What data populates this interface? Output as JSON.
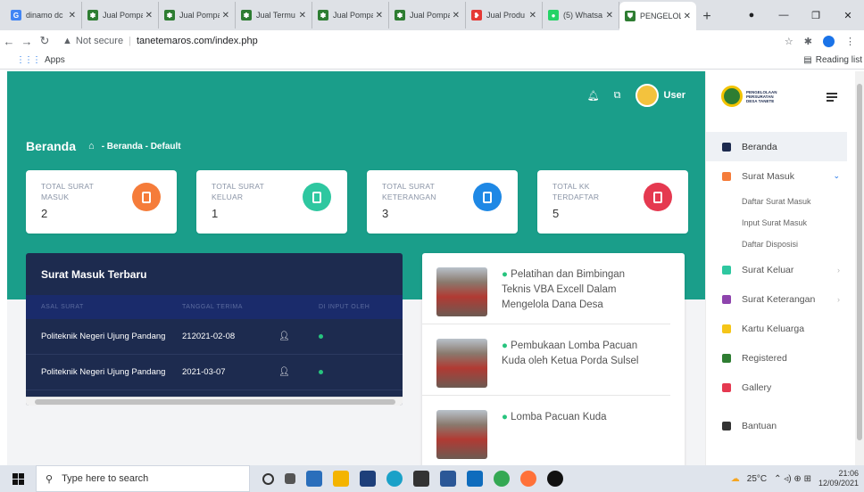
{
  "browser": {
    "tabs": [
      {
        "label": "dinamo dc",
        "color": "#4285f4",
        "glyph": "G"
      },
      {
        "label": "Jual Pompa",
        "color": "#2e7d32",
        "glyph": "✽"
      },
      {
        "label": "Jual Pompa",
        "color": "#2e7d32",
        "glyph": "✽"
      },
      {
        "label": "Jual Termu",
        "color": "#2e7d32",
        "glyph": "✽"
      },
      {
        "label": "Jual Pompa",
        "color": "#2e7d32",
        "glyph": "✽"
      },
      {
        "label": "Jual Pompa",
        "color": "#2e7d32",
        "glyph": "✽"
      },
      {
        "label": "Jual Produ",
        "color": "#e53935",
        "glyph": "❥"
      },
      {
        "label": "(5) Whatsa",
        "color": "#25d366",
        "glyph": "●"
      },
      {
        "label": "PENGELOL",
        "color": "#2e7d32",
        "glyph": "⛊"
      }
    ],
    "new_tab": "+",
    "window_controls": [
      "●",
      "—",
      "❐",
      "✕"
    ],
    "security": "Not secure",
    "url": "tanetemaros.com/index.php",
    "bookmarks_apps": "Apps",
    "reading_list": "Reading list"
  },
  "header": {
    "user": "User",
    "page_title": "Beranda",
    "breadcrumb": "Beranda",
    "breadcrumb_current": "Default"
  },
  "stats": [
    {
      "label": "TOTAL SURAT MASUK",
      "value": "2",
      "color": "#f57c3a"
    },
    {
      "label": "TOTAL SURAT KELUAR",
      "value": "1",
      "color": "#2ec7a0"
    },
    {
      "label": "TOTAL SURAT KETERANGAN",
      "value": "3",
      "color": "#1e88e5"
    },
    {
      "label": "TOTAL KK TERDAFTAR",
      "value": "5",
      "color": "#e53950"
    }
  ],
  "recent": {
    "title": "Surat Masuk Terbaru",
    "columns": [
      "ASAL SURAT",
      "TANGGAL TERIMA",
      "",
      "DI INPUT OLEH"
    ],
    "rows": [
      {
        "asal": "Politeknik Negeri Ujung Pandang",
        "tanggal": "212021-02-08"
      },
      {
        "asal": "Politeknik Negeri Ujung Pandang",
        "tanggal": "2021-03-07"
      }
    ]
  },
  "news": [
    "Pelatihan dan Bimbingan Teknis VBA Excell Dalam Mengelola Dana Desa",
    "Pembukaan Lomba Pacuan Kuda oleh Ketua Porda Sulsel",
    "Lomba Pacuan Kuda"
  ],
  "sidebar": {
    "logo_text": "PENGELOLAAN PERSURATAN DESA TANETE",
    "items": [
      {
        "label": "Beranda",
        "color": "#1d2b4f"
      },
      {
        "label": "Surat Masuk",
        "color": "#f57c3a"
      },
      {
        "label": "Daftar Surat Masuk"
      },
      {
        "label": "Input Surat Masuk"
      },
      {
        "label": "Daftar Disposisi"
      },
      {
        "label": "Surat Keluar",
        "color": "#2ec7a0"
      },
      {
        "label": "Surat Keterangan",
        "color": "#8e44ad"
      },
      {
        "label": "Kartu Keluarga",
        "color": "#f5c518"
      },
      {
        "label": "Registered",
        "color": "#2e7d32"
      },
      {
        "label": "Gallery",
        "color": "#e53950"
      },
      {
        "label": "Bantuan",
        "color": "#333333"
      }
    ]
  },
  "taskbar": {
    "search_placeholder": "Type here to search",
    "temperature": "25°C",
    "time": "21:06",
    "date": "12/09/2021"
  }
}
